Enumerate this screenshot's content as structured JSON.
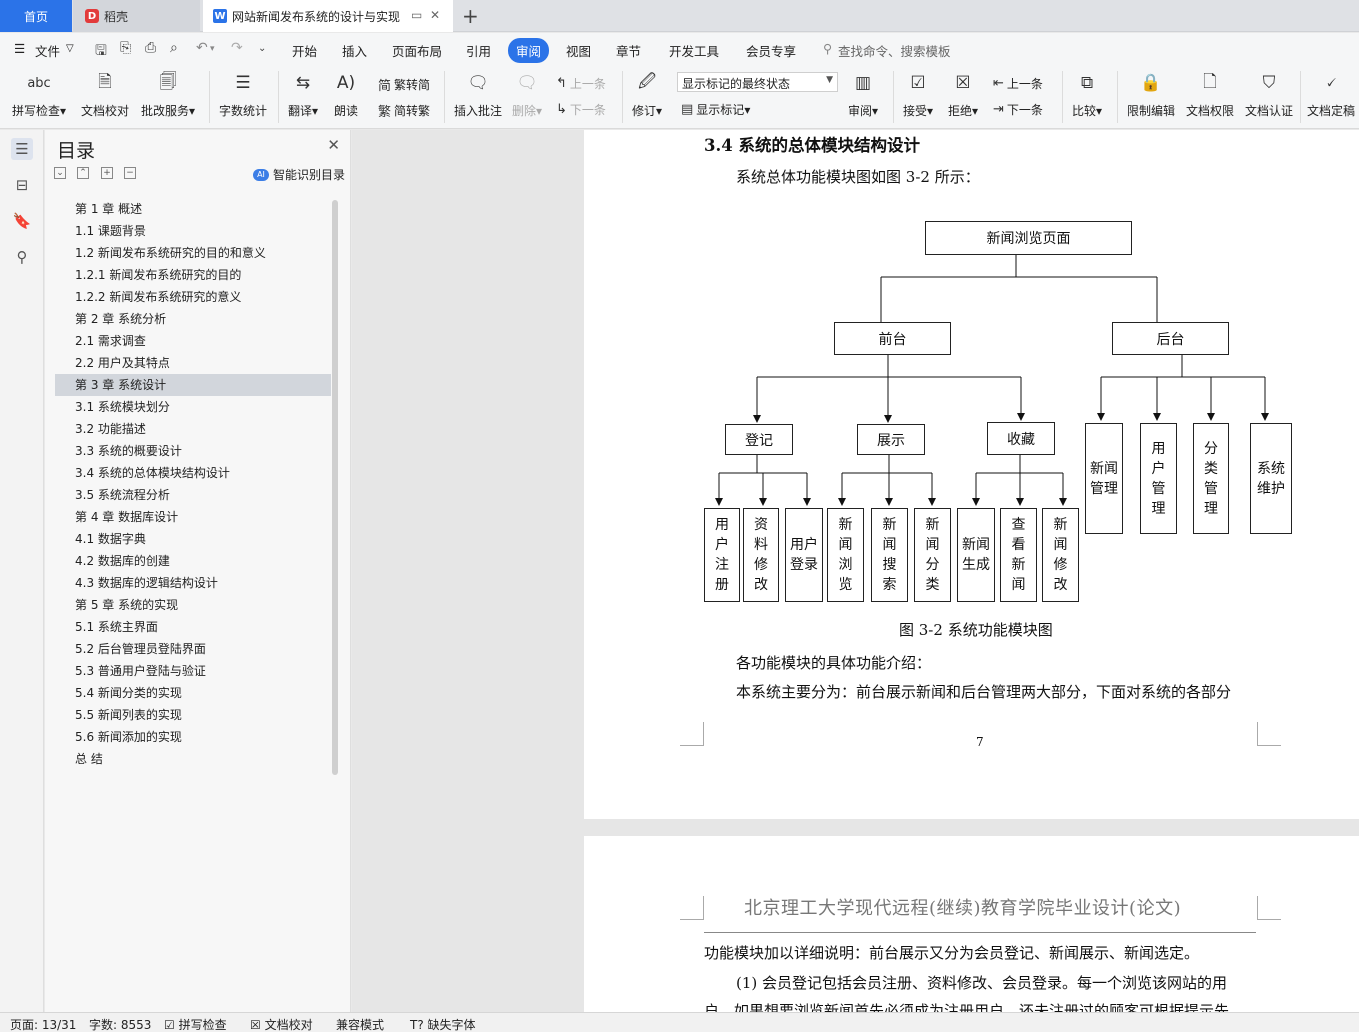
{
  "tabs": {
    "home": "首页",
    "docer": "稻壳",
    "document": "网站新闻发布系统的设计与实现",
    "new_tab_icon": "+"
  },
  "menu": {
    "file": "文件",
    "items": [
      "开始",
      "插入",
      "页面布局",
      "引用",
      "审阅",
      "视图",
      "章节",
      "开发工具",
      "会员专享"
    ],
    "search_placeholder": "查找命令、搜索模板"
  },
  "ribbon": {
    "spell_check": "拼写检查",
    "doc_proof": "文档校对",
    "revise_service": "批改服务",
    "word_count": "字数统计",
    "translate": "翻译",
    "read_aloud": "朗读",
    "trad_to_simp": "繁转简",
    "simp_to_trad": "简转繁",
    "insert_comment": "插入批注",
    "delete": "删除",
    "prev": "上一条",
    "next": "下一条",
    "revise": "修订",
    "markup_state": "显示标记的最终状态",
    "show_markup": "显示标记",
    "review": "审阅",
    "accept": "接受",
    "reject": "拒绝",
    "prev2": "上一条",
    "next2": "下一条",
    "compare": "比较",
    "restrict_edit": "限制编辑",
    "doc_rights": "文档权限",
    "doc_cert": "文档认证",
    "doc_final": "文档定稿"
  },
  "toc": {
    "title": "目录",
    "smart": "智能识别目录",
    "items": [
      "第 1 章  概述",
      "1.1  课题背景",
      "1.2 新闻发布系统研究的目的和意义",
      "1.2.1 新闻发布系统研究的目的",
      "1.2.2 新闻发布系统研究的意义",
      "第 2 章  系统分析",
      "2.1 需求调查",
      "2.2 用户及其特点",
      "第 3 章  系统设计",
      "3.1 系统模块划分",
      "3.2  功能描述",
      "3.3 系统的概要设计",
      "3.4  系统的总体模块结构设计",
      "3.5 系统流程分析",
      "第 4 章  数据库设计",
      "4.1 数据字典",
      "4.2 数据库的创建",
      "4.3 数据库的逻辑结构设计",
      "第 5 章  系统的实现",
      "5.1  系统主界面",
      "5.2  后台管理员登陆界面",
      "5.3  普通用户登陆与验证",
      "5.4 新闻分类的实现",
      "5.5  新闻列表的实现",
      "5.6  新闻添加的实现",
      "总    结"
    ],
    "active_index": 8
  },
  "document": {
    "section_heading": "3.4  系统的总体模块结构设计",
    "intro": "系统总体功能模块图如图 3-2 所示：",
    "diagram": {
      "root": "新闻浏览页面",
      "front": "前台",
      "back": "后台",
      "register": "登记",
      "display": "展示",
      "favorite": "收藏",
      "leaves_front": [
        "用户注册",
        "资料修改",
        "用户登录",
        "新闻浏览",
        "新闻搜索",
        "新闻分类",
        "新闻生成",
        "查看新闻",
        "新闻修改"
      ],
      "leaves_back": [
        "新闻管理",
        "用户管理",
        "分类管理",
        "系统维护"
      ]
    },
    "caption": "图 3-2  系统功能模块图",
    "para1": "各功能模块的具体功能介绍：",
    "para2": "本系统主要分为：前台展示新闻和后台管理两大部分，下面对系统的各部分",
    "page_number": "7",
    "page2_header": "北京理工大学现代远程(继续)教育学院毕业设计(论文)",
    "page2_p1": "功能模块加以详细说明：前台展示又分为会员登记、新闻展示、新闻选定。",
    "page2_p2": "(1)  会员登记包括会员注册、资料修改、会员登录。每一个浏览该网站的用",
    "page2_p3": "户，如果想要浏览新闻首先必须成为注册用户，还未注册过的顾客可根据提示先"
  },
  "status": {
    "page": "页面: 13/31",
    "words": "字数: 8553",
    "spell": "拼写检查",
    "proof": "文档校对",
    "compat": "兼容模式",
    "missing_font": "缺失字体"
  }
}
